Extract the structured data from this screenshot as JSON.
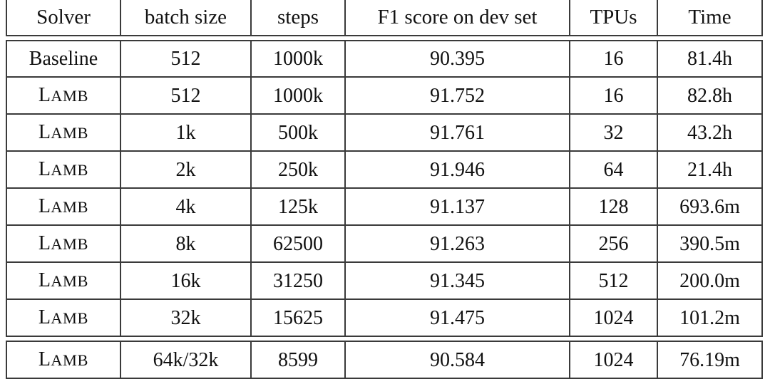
{
  "table": {
    "caption_visible": false,
    "columns": [
      {
        "key": "solver",
        "label": "Solver"
      },
      {
        "key": "batch_size",
        "label": "batch size"
      },
      {
        "key": "steps",
        "label": "steps"
      },
      {
        "key": "f1",
        "label": "F1 score on dev set"
      },
      {
        "key": "tpus",
        "label": "TPUs"
      },
      {
        "key": "time",
        "label": "Time"
      }
    ],
    "solver_names": {
      "baseline": "Baseline",
      "lamb_first": "L",
      "lamb_rest": "amb"
    },
    "rows": [
      {
        "solver": "Baseline",
        "solver_style": "plain",
        "batch_size": "512",
        "steps": "1000k",
        "f1": "90.395",
        "tpus": "16",
        "time": "81.4h"
      },
      {
        "solver": "Lamb",
        "solver_style": "smallcaps",
        "batch_size": "512",
        "steps": "1000k",
        "f1": "91.752",
        "tpus": "16",
        "time": "82.8h"
      },
      {
        "solver": "Lamb",
        "solver_style": "smallcaps",
        "batch_size": "1k",
        "steps": "500k",
        "f1": "91.761",
        "tpus": "32",
        "time": "43.2h"
      },
      {
        "solver": "Lamb",
        "solver_style": "smallcaps",
        "batch_size": "2k",
        "steps": "250k",
        "f1": "91.946",
        "tpus": "64",
        "time": "21.4h"
      },
      {
        "solver": "Lamb",
        "solver_style": "smallcaps",
        "batch_size": "4k",
        "steps": "125k",
        "f1": "91.137",
        "tpus": "128",
        "time": "693.6m"
      },
      {
        "solver": "Lamb",
        "solver_style": "smallcaps",
        "batch_size": "8k",
        "steps": "62500",
        "f1": "91.263",
        "tpus": "256",
        "time": "390.5m"
      },
      {
        "solver": "Lamb",
        "solver_style": "smallcaps",
        "batch_size": "16k",
        "steps": "31250",
        "f1": "91.345",
        "tpus": "512",
        "time": "200.0m"
      },
      {
        "solver": "Lamb",
        "solver_style": "smallcaps",
        "batch_size": "32k",
        "steps": "15625",
        "f1": "91.475",
        "tpus": "1024",
        "time": "101.2m"
      }
    ],
    "final_row": {
      "solver": "Lamb",
      "solver_style": "smallcaps",
      "batch_size": "64k/32k",
      "steps": "8599",
      "f1": "90.584",
      "tpus": "1024",
      "time": "76.19m"
    },
    "style": {
      "rule_color": "#3a3a3a",
      "text_color": "#111111",
      "background": "#ffffff"
    }
  }
}
